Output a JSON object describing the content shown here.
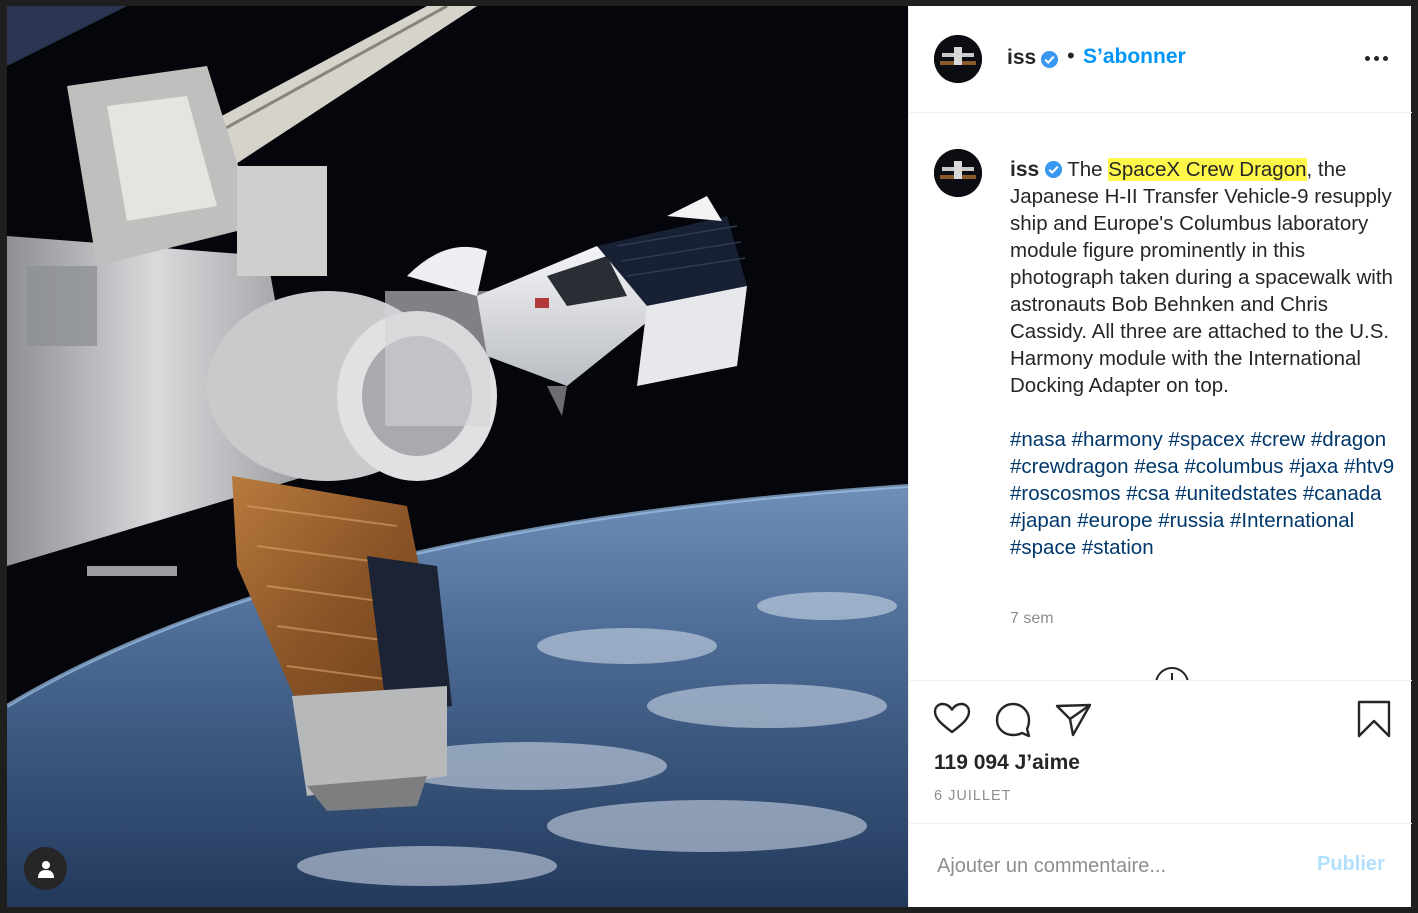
{
  "post": {
    "username": "iss",
    "follow_label": "S’abonner",
    "separator": "•",
    "caption": {
      "pre_highlight": "The ",
      "highlight": "SpaceX Crew Dragon",
      "post_highlight": ", the Japanese H-II Transfer Vehicle-9 resupply ship and Europe's Columbus laboratory module figure prominently in this photograph taken during a spacewalk with astronauts Bob Behnken and Chris Cassidy. All three are attached to the U.S. Harmony module with the International Docking Adapter on top."
    },
    "hashtags": [
      "#nasa",
      "#harmony",
      "#spacex",
      "#crew",
      "#dragon",
      "#crewdragon",
      "#esa",
      "#columbus",
      "#jaxa",
      "#htv9",
      "#roscosmos",
      "#csa",
      "#unitedstates",
      "#canada",
      "#japan",
      "#europe",
      "#russia",
      "#International",
      "#space",
      "#station"
    ],
    "time_ago": "7 sem",
    "likes": "119 094 J’aime",
    "date": "6 JUILLET"
  },
  "comment": {
    "placeholder": "Ajouter un commentaire...",
    "publish_label": "Publier"
  },
  "colors": {
    "link": "#0095f6",
    "hashtag": "#00376b",
    "highlight": "#fff84a",
    "verified": "#3897f0",
    "muted": "#8e8e8e"
  },
  "icons": [
    "verified-badge-icon",
    "more-options-icon",
    "heart-icon",
    "comment-icon",
    "share-icon",
    "bookmark-icon",
    "load-more-comments-icon",
    "user-tags-icon"
  ]
}
